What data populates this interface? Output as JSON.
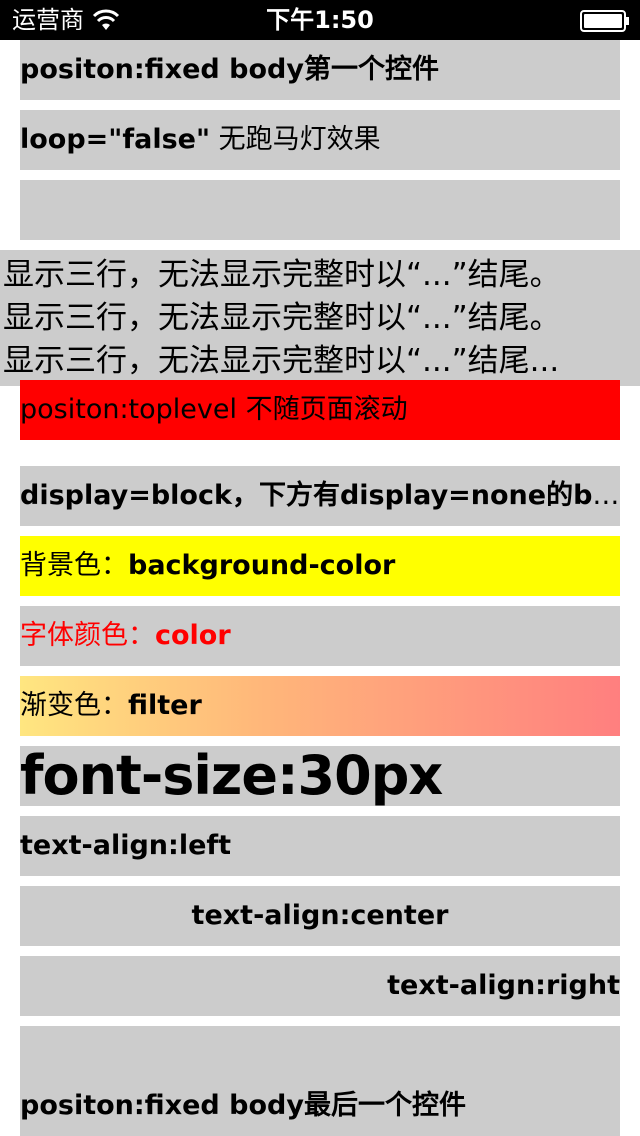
{
  "status_bar": {
    "carrier": "运营商",
    "time": "下午1:50",
    "icons": [
      "wifi-icon",
      "battery-icon"
    ]
  },
  "items": {
    "fixed_first": "positon:fixed body第一个控件",
    "loop_bold": "loop=\"false\"",
    "loop_rest": " 无跑马灯效果",
    "empty_box": "",
    "multiline": [
      "显示三行，无法显示完整时以“...”结尾。",
      "显示三行，无法显示完整时以“...”结尾。",
      "显示三行，无法显示完整时以“...”结尾..."
    ],
    "toplevel": "positon:toplevel 不随页面滚动",
    "display_block": "display=block，下方有display=none的b...",
    "bg_label": "背景色：",
    "bg_value": "background-color",
    "color_label": "字体颜色：",
    "color_value": "color",
    "gradient_label": "渐变色：",
    "gradient_value": "filter",
    "font_size": "font-size:30px",
    "align_left": "text-align:left",
    "align_center": "text-align:center",
    "align_right": "text-align:right",
    "fixed_last": "positon:fixed body最后一个控件"
  },
  "colors": {
    "box_bg": "#cccccc",
    "toplevel_bg": "#ff0000",
    "yellow_bg": "#ffff00",
    "red_text": "#ff0000",
    "gradient_start": "#ffe680",
    "gradient_end": "#ff7f7f"
  }
}
